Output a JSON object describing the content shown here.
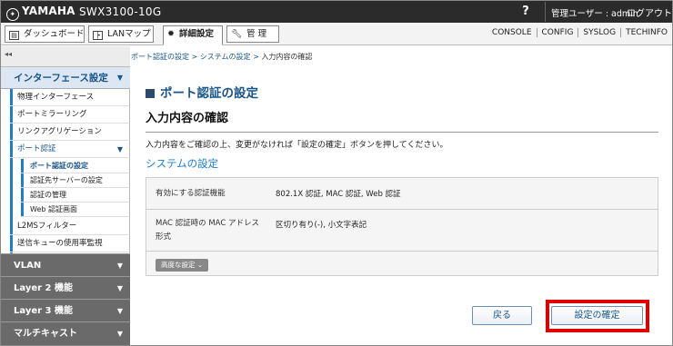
{
  "header": {
    "brand": "YAMAHA",
    "model": "SWX3100-10G",
    "help_label": "?",
    "user": "管理ユーザー : admin",
    "logout": "ログアウト"
  },
  "nav": {
    "tabs": [
      {
        "label": "ダッシュボード",
        "icon": "dashboard-icon"
      },
      {
        "label": "LANマップ",
        "icon": "lan-map-icon"
      },
      {
        "label": "詳細設定",
        "icon": "gear-icon"
      },
      {
        "label": "管 理",
        "icon": "wrench-icon"
      }
    ],
    "right_links": [
      "CONSOLE",
      "CONFIG",
      "SYSLOG",
      "TECHINFO"
    ]
  },
  "sidebar": {
    "collapse_label": "◂◂",
    "open_section": "インターフェース設定",
    "items": [
      "物理インターフェース",
      "ポートミラーリング",
      "リンクアグリゲーション",
      "ポート認証"
    ],
    "subitems": [
      "ポート認証の設定",
      "認証先サーバーの設定",
      "認証の管理",
      "Web 認証画面"
    ],
    "items_after": [
      "L2MSフィルター",
      "送信キューの使用率監視"
    ],
    "sections": [
      "VLAN",
      "Layer 2 機能",
      "Layer 3 機能",
      "マルチキャスト"
    ]
  },
  "main": {
    "breadcrumb": [
      "ポート認証の設定",
      "システムの設定",
      "入力内容の確認"
    ],
    "breadcrumb_sep": " > ",
    "title": "ポート認証の設定",
    "subtitle": "入力内容の確認",
    "description": "入力内容をご確認の上、変更がなければ「設定の確定」ボタンを押してください。",
    "section_title": "システムの設定",
    "rows": [
      {
        "label": "有効にする認証機能",
        "value": "802.1X 認証, MAC 認証, Web 認証"
      },
      {
        "label": "MAC 認証時の MAC アドレス形式",
        "value": "区切り有り(-), 小文字表記"
      }
    ],
    "advanced_button": "高度な設定",
    "back_button": "戻る",
    "confirm_button": "設定の確定"
  }
}
